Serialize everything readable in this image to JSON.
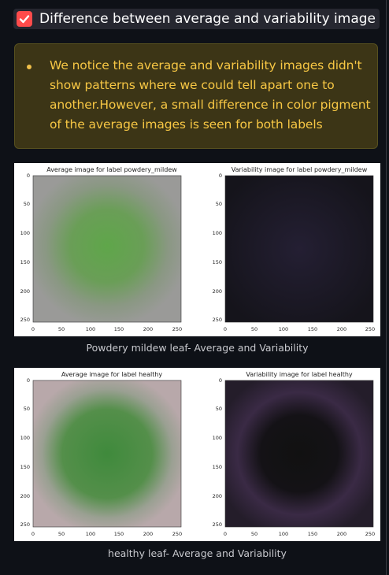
{
  "header": {
    "title": "Difference between average and variability image",
    "checked": true
  },
  "alert": {
    "text": "We notice the average and variability images didn't show patterns where we could tell apart one to another.However, a small difference in color pigment of the average images is seen for both labels",
    "accent_color": "#f7c744"
  },
  "figures": [
    {
      "left_title": "Average image for label powdery_mildew",
      "right_title": "Variability image for label powdery_mildew",
      "y_ticks": [
        "0",
        "50",
        "100",
        "150",
        "200",
        "250"
      ],
      "x_ticks": [
        "0",
        "50",
        "100",
        "150",
        "200",
        "250"
      ],
      "caption": "Powdery mildew leaf- Average and Variability"
    },
    {
      "left_title": "Average image for label healthy",
      "right_title": "Variability image for label healthy",
      "y_ticks": [
        "0",
        "50",
        "100",
        "150",
        "200",
        "250"
      ],
      "x_ticks": [
        "0",
        "50",
        "100",
        "150",
        "200",
        "250"
      ],
      "caption": "healthy leaf- Average and Variability"
    }
  ]
}
